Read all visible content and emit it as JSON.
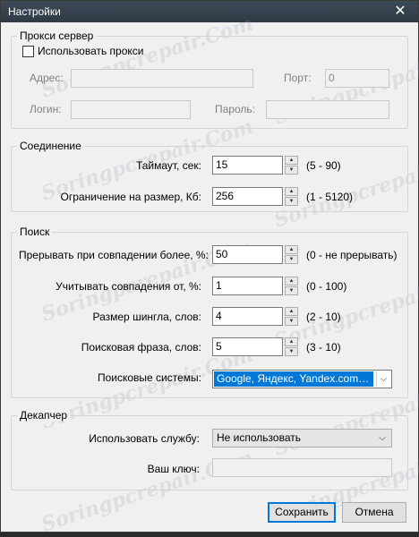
{
  "window": {
    "title": "Настройки"
  },
  "proxy": {
    "legend": "Прокси сервер",
    "use_proxy_label": "Использовать прокси",
    "address_label": "Адрес:",
    "address_value": "",
    "port_label": "Порт:",
    "port_value": "0",
    "login_label": "Логин:",
    "login_value": "",
    "password_label": "Пароль:",
    "password_value": ""
  },
  "connection": {
    "legend": "Соединение",
    "timeout_label": "Таймаут, сек:",
    "timeout_value": "15",
    "timeout_range": "(5 - 90)",
    "size_limit_label": "Ограничение на размер, Кб:",
    "size_limit_value": "256",
    "size_limit_range": "(1 - 5120)"
  },
  "search": {
    "legend": "Поиск",
    "interrupt_label": "Прерывать при совпадении более, %:",
    "interrupt_value": "50",
    "interrupt_range": "(0 - не прерывать)",
    "count_from_label": "Учитывать совпадения от, %:",
    "count_from_value": "1",
    "count_from_range": "(0 - 100)",
    "shingle_label": "Размер шингла, слов:",
    "shingle_value": "4",
    "shingle_range": "(2 - 10)",
    "phrase_label": "Поисковая фраза, слов:",
    "phrase_value": "5",
    "phrase_range": "(3 - 10)",
    "engines_label": "Поисковые системы:",
    "engines_value": "Google, Яндекс, Yandex.com, Ra..."
  },
  "decaptcha": {
    "legend": "Декапчер",
    "service_label": "Использовать службу:",
    "service_value": "Не использовать",
    "key_label": "Ваш ключ:",
    "key_value": ""
  },
  "buttons": {
    "save": "Сохранить",
    "cancel": "Отмена"
  },
  "watermark": "Soringpcrepair.Com"
}
